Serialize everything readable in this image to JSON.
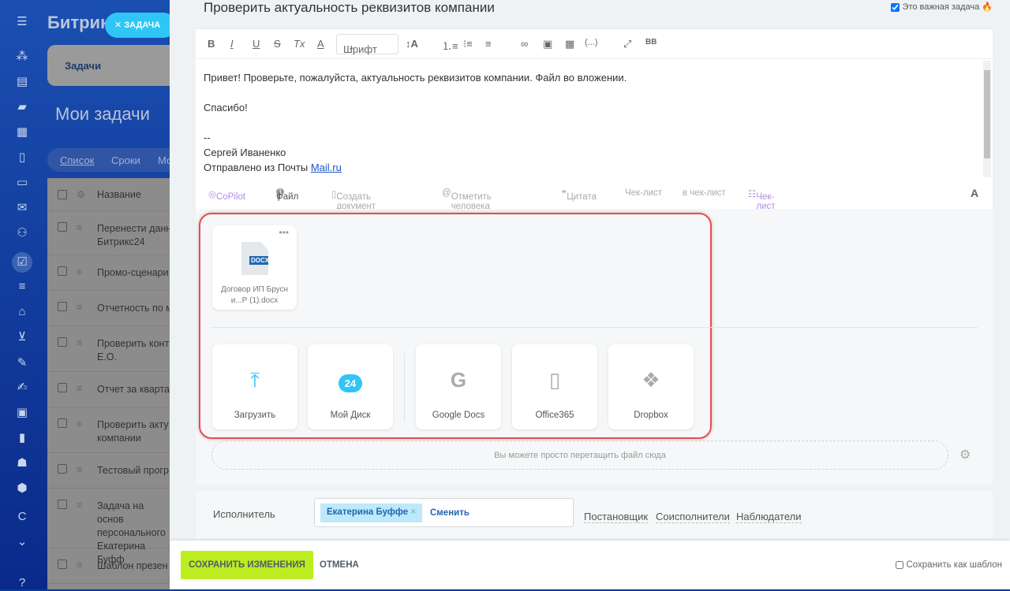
{
  "app": {
    "logo": "Битрикс",
    "task_pill": "ЗАДАЧА",
    "tab": "Задачи",
    "page_title": "Мои задачи",
    "views": [
      "Список",
      "Сроки",
      "Мо"
    ],
    "column": "Название",
    "tasks": [
      "Перенести данн Битрикс24",
      "Промо-сценари",
      "Отчетность по м",
      "Проверить конт Е.О.",
      "Отчет за кварта",
      "Проверить акту компании",
      "Тестовый прогр",
      "Задача на основ персонального Екатерина Буфф",
      "Шаблон презен"
    ]
  },
  "nav_icons": [
    "menu-icon",
    "feed-icon",
    "tasks-board-icon",
    "chat-icon",
    "calendar-icon",
    "docs-icon",
    "drive-icon",
    "mail-icon",
    "group-icon",
    "tasks-icon",
    "crm-icon",
    "shop-icon",
    "cart-icon",
    "invoice-icon",
    "sign-icon",
    "contacts-icon",
    "analytics-icon",
    "robot-icon",
    "box-icon",
    "c-icon",
    "more-icon",
    "help-icon"
  ],
  "task": {
    "title": "Проверить актуальность реквизитов компании",
    "important_label": "Это важная задача",
    "important_checked": true
  },
  "toolbar": {
    "bold": "B",
    "italic": "I",
    "underline": "U",
    "strike": "S",
    "clear": "Tx",
    "color": "A",
    "font": "Шрифт",
    "size": "↕A",
    "code": "(...)",
    "bb": "BB"
  },
  "editor": {
    "lines": [
      "Привет! Проверьте, пожалуйста, актуальность реквизитов компании. Файл во вложении.",
      "",
      "Спасибо!",
      "",
      "--",
      "Сергей Иваненко"
    ],
    "sent_from": "Отправлено из Почты ",
    "sent_link": "Mail.ru"
  },
  "bottom_bar": {
    "copilot": "CoPilot",
    "file": "Файл",
    "file_count": "1",
    "create_doc": "Создать документ",
    "mention": "Отметить человека",
    "quote": "Цитата",
    "checklist": "Чек-лист",
    "to_checklist": "в чек-лист",
    "checklist2": "Чек-лист",
    "font_a": "A"
  },
  "attachments": {
    "file": {
      "type": "DOCX",
      "name": "Договор ИП Брусн и...Р (1).docx"
    },
    "sources": [
      {
        "label": "Загрузить",
        "icon": "upload-icon"
      },
      {
        "label": "Мой Диск",
        "icon": "bitrix24-disk-icon"
      },
      {
        "label": "Google Docs",
        "icon": "google-icon"
      },
      {
        "label": "Office365",
        "icon": "office-icon"
      },
      {
        "label": "Dropbox",
        "icon": "dropbox-icon"
      }
    ],
    "drop_hint": "Вы можете просто перетащить файл сюда"
  },
  "executor": {
    "label": "Исполнитель",
    "person": "Екатерина Буффе",
    "change": "Сменить",
    "roles": [
      "Постановщик",
      "Соисполнители",
      "Наблюдатели"
    ]
  },
  "footer": {
    "save": "СОХРАНИТЬ ИЗМЕНЕНИЯ",
    "cancel": "ОТМЕНА",
    "template": "Сохранить как шаблон"
  },
  "colors": {
    "accent": "#2fc6f6",
    "save": "#bbed21",
    "highlight": "#ec4a4f"
  }
}
